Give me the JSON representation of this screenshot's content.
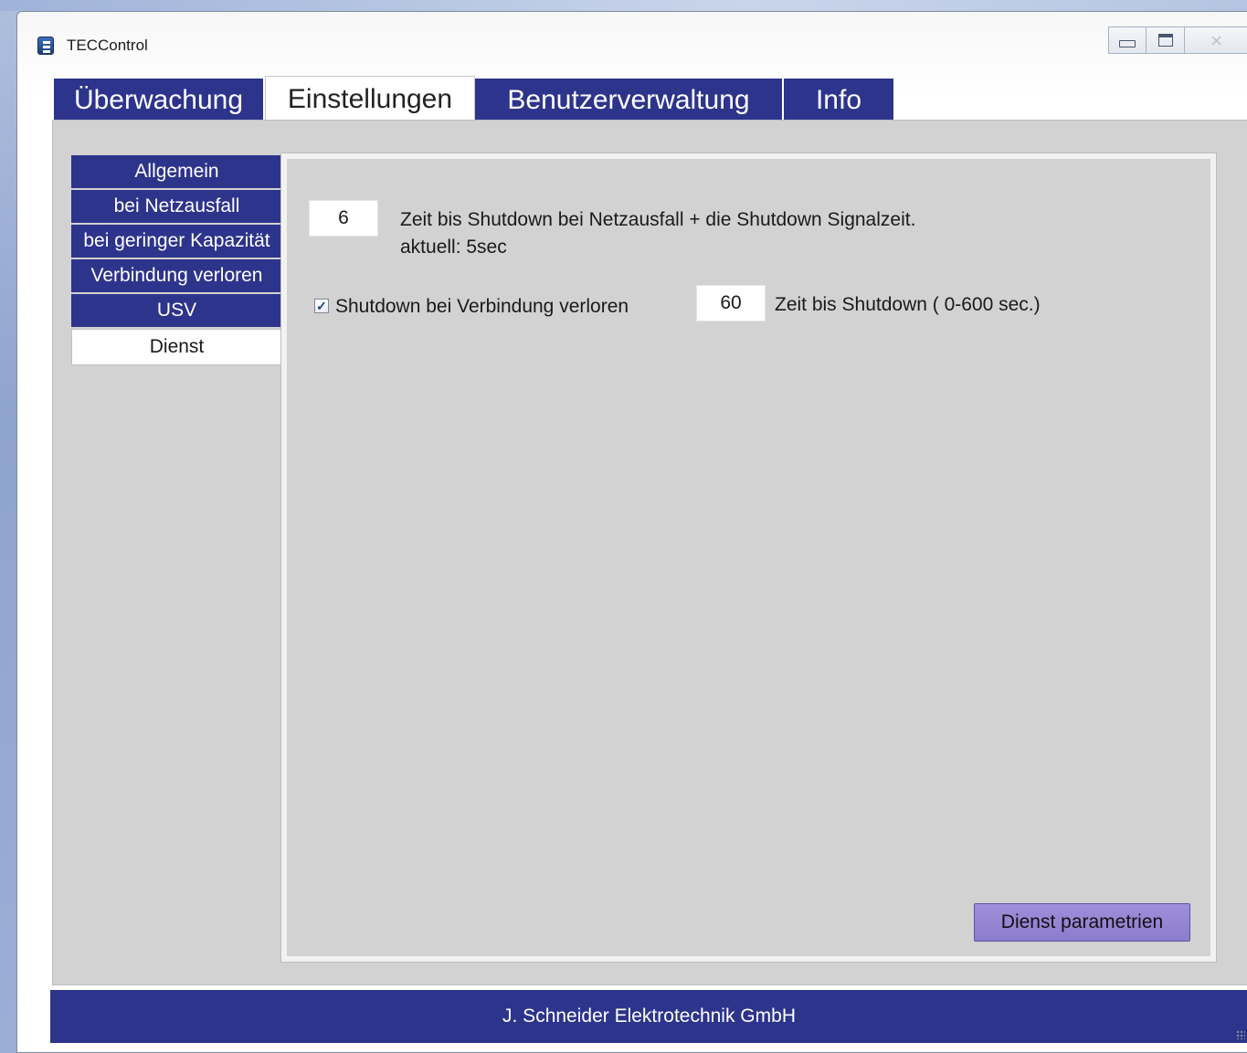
{
  "window": {
    "title": "TECControl",
    "controls": {
      "minimize": "",
      "maximize": "",
      "close": "⨯"
    }
  },
  "tabs": [
    {
      "label": "Überwachung",
      "active": false
    },
    {
      "label": "Einstellungen",
      "active": true
    },
    {
      "label": "Benutzerverwaltung",
      "active": false
    },
    {
      "label": "Info",
      "active": false
    }
  ],
  "sidebar": {
    "items": [
      {
        "label": "Allgemein",
        "active": false
      },
      {
        "label": "bei Netzausfall",
        "active": false
      },
      {
        "label": "bei geringer Kapazität",
        "active": false
      },
      {
        "label": "Verbindung verloren",
        "active": false
      },
      {
        "label": "USV",
        "active": false
      },
      {
        "label": "Dienst",
        "active": true
      }
    ]
  },
  "panel": {
    "shutdown_time_value": "6",
    "shutdown_time_label": "Zeit bis Shutdown bei Netzausfall + die Shutdown Signalzeit.",
    "current_label": "aktuell: 5sec",
    "connection_lost_checkbox": {
      "label": "Shutdown bei Verbindung verloren",
      "checked": true,
      "mark": "✓"
    },
    "connection_lost_time_value": "60",
    "connection_lost_time_label": "Zeit bis Shutdown ( 0-600 sec.)",
    "apply_button": "Dienst parametrien"
  },
  "footer": {
    "company": "J. Schneider Elektrotechnik GmbH"
  },
  "colors": {
    "accent": "#2d348b",
    "button": "#9e8fda",
    "panel_bg": "#d2d2d2"
  }
}
